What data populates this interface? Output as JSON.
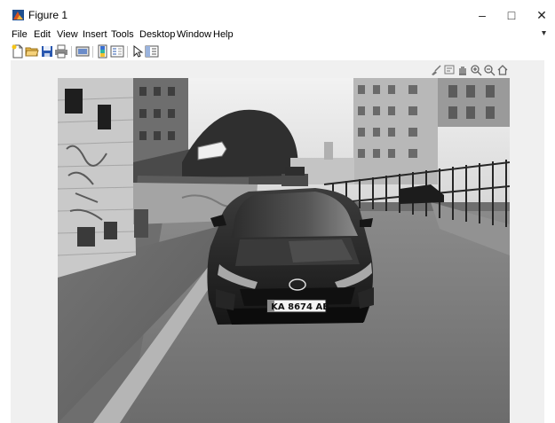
{
  "window": {
    "title": "Figure 1",
    "minimize_glyph": "–",
    "maximize_glyph": "□",
    "close_glyph": "✕"
  },
  "menu": {
    "items": [
      "File",
      "Edit",
      "View",
      "Insert",
      "Tools",
      "Desktop",
      "Window",
      "Help"
    ]
  },
  "toolbar": {
    "buttons": [
      "new-figure-icon",
      "open-file-icon",
      "save-icon",
      "print-icon",
      "link-plot-icon",
      "insert-colorbar-icon",
      "insert-legend-icon",
      "edit-plot-icon",
      "property-inspector-icon"
    ]
  },
  "axes_toolbar": {
    "buttons": [
      "brush-icon",
      "data-tips-icon",
      "pan-icon",
      "zoom-in-icon",
      "zoom-out-icon",
      "home-icon"
    ]
  },
  "image": {
    "license_plate": "KA 8674 AB"
  },
  "colors": {
    "figure_background": "#f0f0f0",
    "matlab_icon": "#d9541e"
  }
}
